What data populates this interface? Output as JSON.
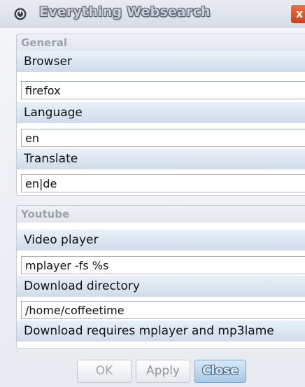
{
  "window": {
    "title": "Everything Websearch",
    "close_glyph": "x",
    "app_icon": "power-icon"
  },
  "general": {
    "header": "General",
    "browser_label": "Browser",
    "browser_value": "firefox",
    "language_label": "Language",
    "language_value": "en",
    "translate_label": "Translate",
    "translate_value": "en|de"
  },
  "youtube": {
    "header": "Youtube",
    "video_player_label": "Video player",
    "video_player_value": "mplayer -fs %s",
    "download_dir_label": "Download directory",
    "download_dir_value": "/home/coffeetime",
    "note": "Download requires mplayer and mp3lame"
  },
  "buttons": {
    "ok": "OK",
    "apply": "Apply",
    "close": "Close"
  },
  "colors": {
    "accent": "#a7c8e6",
    "close_red": "#c9401b"
  }
}
